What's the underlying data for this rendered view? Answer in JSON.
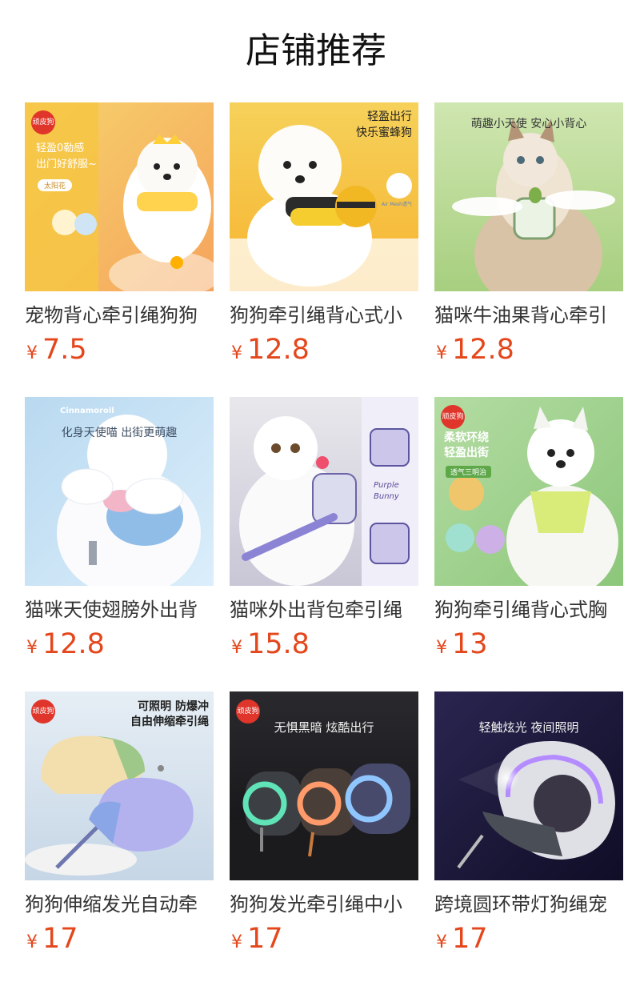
{
  "page": {
    "title": "店铺推荐"
  },
  "products": [
    {
      "name": "宠物背心牵引绳狗狗",
      "currency": "¥",
      "price": "7.5",
      "image": {
        "bg": [
          "#f7d36b",
          "#f5a45d"
        ],
        "brand": "顽皮狗",
        "lines": [
          "轻盈0勒感",
          "出门好舒服~"
        ],
        "tag": "太阳花"
      }
    },
    {
      "name": "狗狗牵引绳背心式小",
      "currency": "¥",
      "price": "12.8",
      "image": {
        "bg": [
          "#f6d15a",
          "#f7b430"
        ],
        "lines": [
          "轻盈出行",
          "快乐蜜蜂狗"
        ],
        "tag": "Air Mesh透气"
      }
    },
    {
      "name": "猫咪牛油果背心牵引",
      "currency": "¥",
      "price": "12.8",
      "image": {
        "bg": [
          "#cfe6b0",
          "#a7cf7f"
        ],
        "lines": [
          "萌趣小天使  安心小背心"
        ]
      }
    },
    {
      "name": "猫咪天使翅膀外出背",
      "currency": "¥",
      "price": "12.8",
      "image": {
        "bg": [
          "#b9d9f0",
          "#dbeefb"
        ],
        "brand": "Cinnamoroll",
        "lines": [
          "化身天使喵 出街更萌趣"
        ]
      }
    },
    {
      "name": "猫咪外出背包牵引绳",
      "currency": "¥",
      "price": "15.8",
      "image": {
        "bg": [
          "#e8e8ec",
          "#c9c6d6"
        ],
        "lines": [
          "Purple",
          "Bunny"
        ]
      }
    },
    {
      "name": "狗狗牵引绳背心式胸",
      "currency": "¥",
      "price": "13",
      "image": {
        "bg": [
          "#b4dca3",
          "#8cc77a"
        ],
        "brand": "顽皮狗",
        "lines": [
          "柔软环绕",
          "轻盈出街"
        ],
        "tag": "透气三明治"
      }
    },
    {
      "name": "狗狗伸缩发光自动牵",
      "currency": "¥",
      "price": "17",
      "image": {
        "bg": [
          "#e6eef5",
          "#c6d6e6"
        ],
        "brand": "顽皮狗",
        "lines": [
          "可照明  防爆冲",
          "自由伸缩牵引绳"
        ]
      }
    },
    {
      "name": "狗狗发光牵引绳中小",
      "currency": "¥",
      "price": "17",
      "image": {
        "bg": [
          "#2a2a2e",
          "#111114"
        ],
        "brand": "顽皮狗",
        "lines": [
          "无惧黑暗  炫酷出行"
        ]
      }
    },
    {
      "name": "跨境圆环带灯狗绳宠",
      "currency": "¥",
      "price": "17",
      "image": {
        "bg": [
          "#2a2550",
          "#0f0d26"
        ],
        "lines": [
          "轻触炫光 夜间照明"
        ]
      }
    }
  ]
}
